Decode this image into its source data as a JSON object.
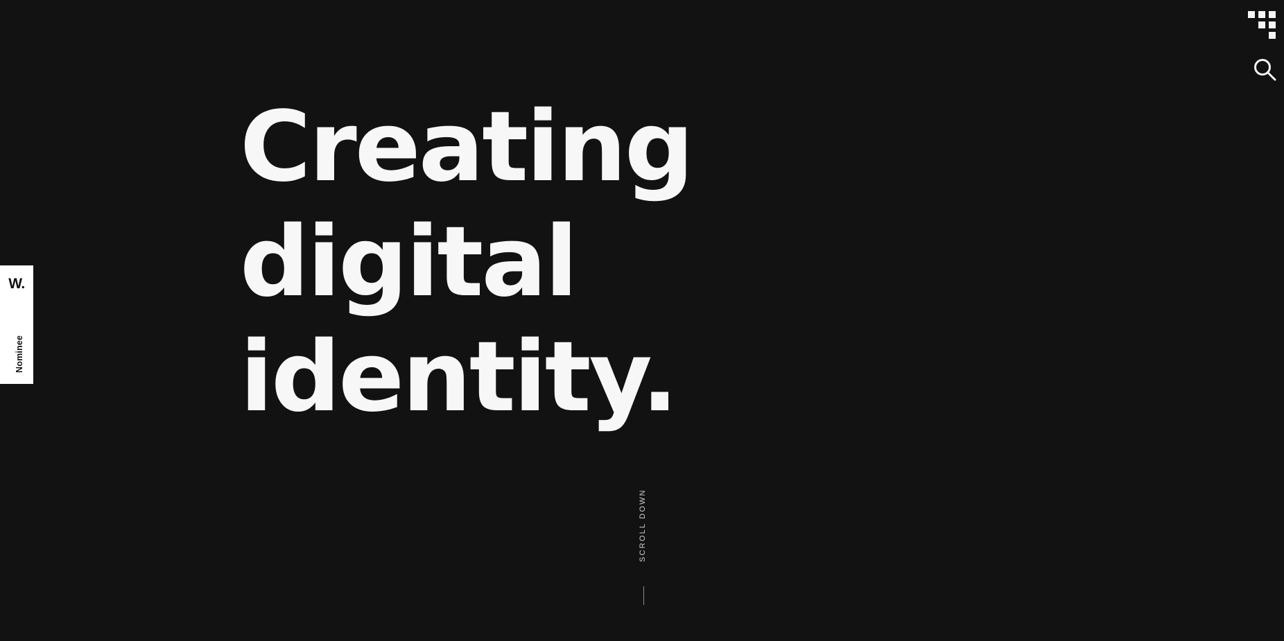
{
  "colors": {
    "background": "#121212",
    "foreground": "#f7f7f7",
    "badge_background": "#ffffff",
    "badge_text": "#111111"
  },
  "header": {
    "menu_icon": "pixel-grid-menu-icon",
    "search_icon": "search-icon"
  },
  "award_badge": {
    "logo": "W.",
    "label": "Nominee"
  },
  "hero": {
    "lines": [
      "Creating",
      "digital",
      "identity."
    ]
  },
  "scroll": {
    "label": "SCROLL DOWN"
  }
}
